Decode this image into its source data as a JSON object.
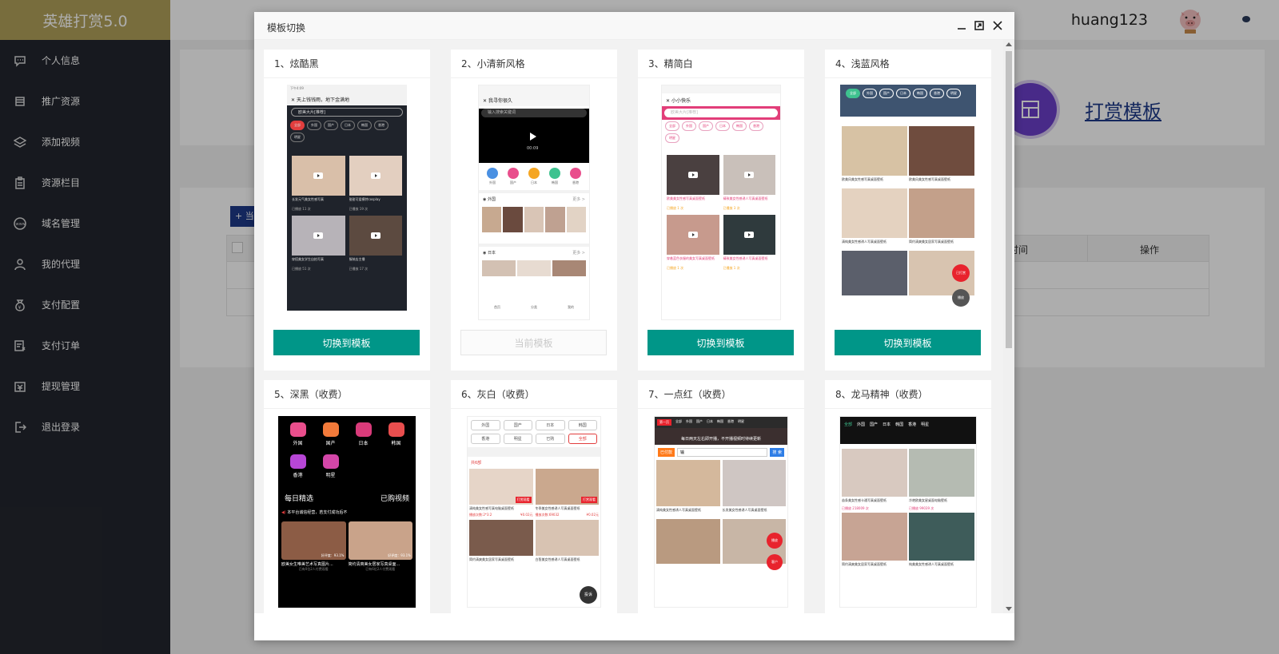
{
  "sidebar": {
    "brand": "英雄打赏5.0",
    "items": [
      {
        "label": "个人信息",
        "icon": "chat-icon"
      },
      {
        "label": "推广资源",
        "icon": "stack-icon"
      },
      {
        "label": "添加视频",
        "icon": "layers-icon"
      },
      {
        "label": "资源栏目",
        "icon": "clipboard-icon"
      },
      {
        "label": "域名管理",
        "icon": "www-icon"
      },
      {
        "label": "我的代理",
        "icon": "user-icon"
      },
      {
        "label": "支付配置",
        "icon": "moneybag-icon"
      },
      {
        "label": "支付订单",
        "icon": "order-icon"
      },
      {
        "label": "提现管理",
        "icon": "withdraw-icon"
      },
      {
        "label": "退出登录",
        "icon": "logout-icon"
      }
    ]
  },
  "header": {
    "username": "huang123"
  },
  "main": {
    "template_link": "打赏模板",
    "add_button_peek": "+ 当",
    "table_columns": [
      "时间",
      "操作"
    ]
  },
  "modal": {
    "title": "模板切换",
    "cards": [
      {
        "title": "1、炫酷黑",
        "button": "切换到模板",
        "current": false
      },
      {
        "title": "2、小清新风格",
        "button": "当前模板",
        "current": true
      },
      {
        "title": "3、精简白",
        "button": "切换到模板",
        "current": false
      },
      {
        "title": "4、浅蓝风格",
        "button": "切换到模板",
        "current": false
      },
      {
        "title": "5、深黑（收费）",
        "button": "",
        "current": false
      },
      {
        "title": "6、灰白（收费）",
        "button": "",
        "current": false
      },
      {
        "title": "7、一点红（收费）",
        "button": "",
        "current": false
      },
      {
        "title": "8、龙马精神（收费）",
        "button": "",
        "current": false
      }
    ]
  },
  "previews": {
    "p1": {
      "status": "下午4:09",
      "bar": "天上钱钱雨，地下金满地",
      "search": "欧美大片[推荐]",
      "tags": [
        "全部",
        "外国",
        "国产",
        "日本",
        "韩国",
        "香港",
        "明星"
      ],
      "captions": [
        "长发元气美女性感写真",
        "甜甜可爱模特cosplay",
        "穿搭美女学生自拍写真",
        "服装店主播"
      ],
      "views": [
        "已播放 11 次",
        "已播放 19 次",
        "已播放 51 次",
        "已播放 17 次"
      ]
    },
    "p2": {
      "bar": "我寻你很久",
      "search": "输入搜索关键词",
      "time": "00:09",
      "cats": [
        "外国",
        "国产",
        "日本",
        "韩国",
        "香港"
      ],
      "section1": "外国",
      "section2": "日本",
      "more": "更多 >",
      "tabs": [
        "首页",
        "分类",
        "我的"
      ]
    },
    "p3": {
      "title": "小小快乐",
      "search": "欧美大片[推荐]",
      "tags": [
        "全部",
        "外国",
        "国产",
        "日本",
        "韩国",
        "香港",
        "明星"
      ],
      "captions": [
        "欧美美女性感写真桌面壁纸",
        "精致美女性感诱人写真桌面壁纸",
        "穿着蓝色衣服的美女写真桌面壁纸",
        "精致美女性感诱人写真桌面壁纸"
      ],
      "views": [
        "已播放 1 次",
        "已播放 3 次",
        "已播放 1 次",
        "已播放 1 次"
      ]
    },
    "p4": {
      "tags": [
        "全部",
        "外国",
        "国产",
        "日本",
        "韩国",
        "香港",
        "明星"
      ],
      "captions": [
        "欧美风美女性感写真桌面壁纸",
        "欧美风美女性感写真桌面壁纸",
        "清纯美女性感诱人写真桌面壁纸",
        "简约清爽美女居家写真桌面壁纸"
      ],
      "badge": "已打赏",
      "fab": "播放"
    },
    "p5": {
      "cats": [
        "外国",
        "国产",
        "日本",
        "韩国",
        "香港",
        "明星"
      ],
      "daily": "每日精选",
      "bought": "已购视频",
      "notice": "本平台诚信经营，若支付成功后不",
      "items": [
        {
          "title": "欧美女生唯美艺术写真图片...",
          "meta": "已有0位2人付费观看",
          "rate": "好评度：93.1%"
        },
        {
          "title": "简约清爽美女居家写真桌面...",
          "meta": "已有6位2人付费观看",
          "rate": "好评度：93.1%"
        }
      ]
    },
    "p6": {
      "cats": [
        "外国",
        "国产",
        "日本",
        "韩国",
        "香港",
        "明星",
        "已购",
        "全部"
      ],
      "section": "共6部",
      "captions": [
        "清纯美女性感写真电脑桌面壁纸",
        "冬季美女性感诱人写真桌面壁纸",
        "简约清爽美女居家写真桌面壁纸",
        "白皙美女性感诱人写真桌面壁纸"
      ],
      "metas": [
        "播放次数:2*3:2",
        "¥0.02元",
        "播放次数:69032",
        "¥0.02元"
      ],
      "badges": [
        "打赏观看",
        "打赏观看"
      ],
      "fab": "投诉"
    },
    "p7": {
      "tabs": [
        "第一页",
        "全部",
        "外国",
        "国产",
        "日本",
        "韩国",
        "香港",
        "明星"
      ],
      "notice": "每日两天左右即开播，不开播视频时待续更新",
      "filter": "已付款",
      "search": "输",
      "search_btn": "搜 索",
      "captions": [
        "清纯美女性感诱人写真桌面壁纸",
        "长发美女性感诱人写真桌面壁纸"
      ],
      "fab1": "播放",
      "fab2": "客户"
    },
    "p8": {
      "tabs": [
        "全部",
        "外国",
        "国产",
        "日本",
        "韩国",
        "香港",
        "明星"
      ],
      "captions": [
        "苗条美女性感卡通写真桌面壁纸",
        "冷艳欧美女星桌面电脑壁纸",
        "简约清爽美女居家写真桌面壁纸",
        "纯美美女性感诱人写真桌面壁纸"
      ],
      "views": [
        "已播放 218009 次",
        "已播放 99039 次"
      ]
    }
  },
  "colors": {
    "accent": "#009688",
    "sidebar": "#23262e",
    "brand": "#b1a15a"
  }
}
